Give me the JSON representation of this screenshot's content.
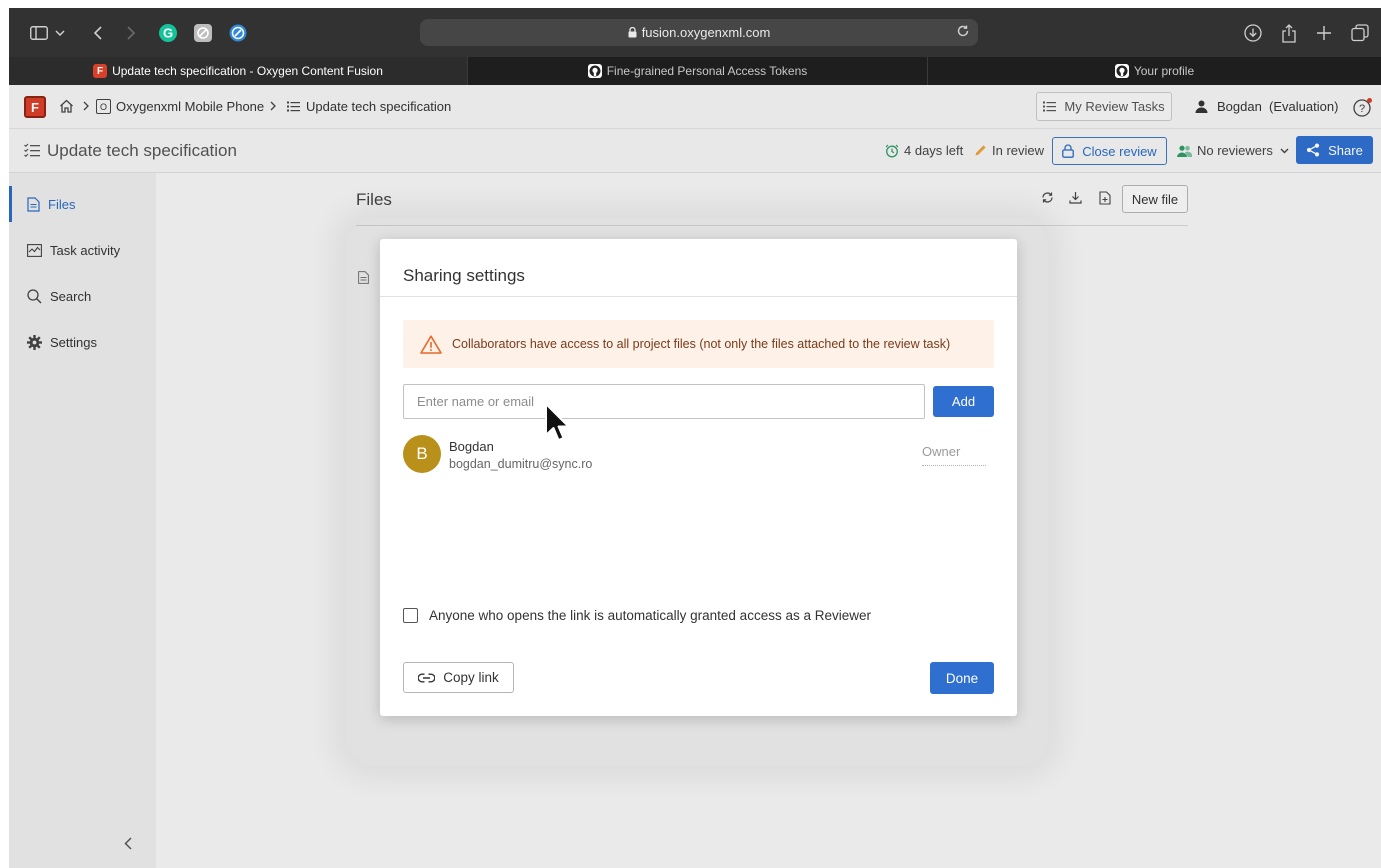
{
  "browser": {
    "url": "fusion.oxygenxml.com",
    "tabs": [
      {
        "label": "Update tech specification - Oxygen Content Fusion",
        "favicon": "F",
        "active": true
      },
      {
        "label": "Fine-grained Personal Access Tokens",
        "favicon": "github-icon",
        "active": false
      },
      {
        "label": "Your profile",
        "favicon": "github-icon",
        "active": false
      }
    ]
  },
  "header": {
    "logo": "F",
    "breadcrumb": {
      "project": "Oxygenxml Mobile Phone",
      "project_badge": "O",
      "task": "Update tech specification"
    },
    "my_review_tasks": "My Review Tasks",
    "user": "Bogdan  (Evaluation)"
  },
  "task": {
    "title": "Update tech specification",
    "due": "4 days left",
    "status": "In review",
    "close_review": "Close review",
    "reviewers": "No reviewers",
    "share": "Share"
  },
  "sidebar": {
    "items": [
      {
        "label": "Files",
        "icon": "file-icon",
        "active": true
      },
      {
        "label": "Task activity",
        "icon": "activity-icon",
        "active": false
      },
      {
        "label": "Search",
        "icon": "search-icon",
        "active": false
      },
      {
        "label": "Settings",
        "icon": "gear-icon",
        "active": false
      }
    ]
  },
  "files": {
    "title": "Files",
    "new_file": "New file"
  },
  "modal": {
    "title": "Sharing settings",
    "warning": "Collaborators have access to all project files (not only the files attached to the review task)",
    "input_placeholder": "Enter name or email",
    "add": "Add",
    "collaborator": {
      "initial": "B",
      "name": "Bogdan",
      "email": "bogdan_dumitru@sync.ro",
      "role": "Owner"
    },
    "reviewer_checkbox": "Anyone who opens the link is automatically granted access as a Reviewer",
    "reviewer_checked": false,
    "copy_link": "Copy link",
    "done": "Done"
  },
  "colors": {
    "accent": "#2f6fcf",
    "warning_bg": "#fdf1e8",
    "warning_icon": "#e8692c",
    "avatar": "#b8901a",
    "brand": "#d8402a"
  }
}
